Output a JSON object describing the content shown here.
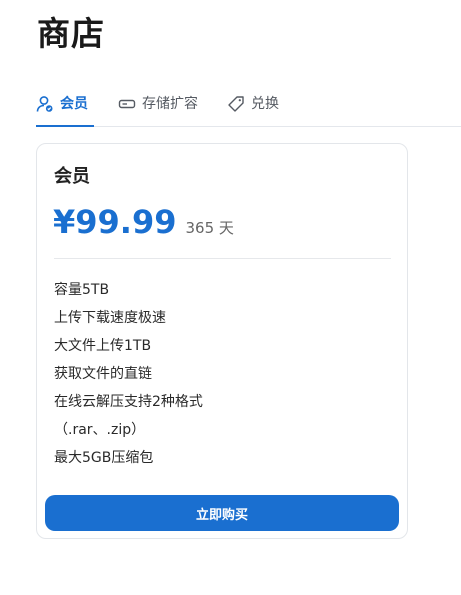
{
  "page": {
    "title": "商店"
  },
  "tabs": [
    {
      "label": "会员",
      "icon": "user-badge-icon",
      "active": true
    },
    {
      "label": "存储扩容",
      "icon": "storage-drive-icon",
      "active": false
    },
    {
      "label": "兑换",
      "icon": "ticket-tag-icon",
      "active": false
    }
  ],
  "plan": {
    "name": "会员",
    "price": "¥99.99",
    "period": "365 天",
    "features": [
      "容量5TB",
      "上传下载速度极速",
      "大文件上传1TB",
      "获取文件的直链",
      "在线云解压支持2种格式",
      "（.rar、.zip）",
      "最大5GB压缩包"
    ],
    "buy_label": "立即购买"
  },
  "colors": {
    "accent": "#1a6fd0",
    "text": "#1f1f1f",
    "border": "#e3e6ea"
  }
}
